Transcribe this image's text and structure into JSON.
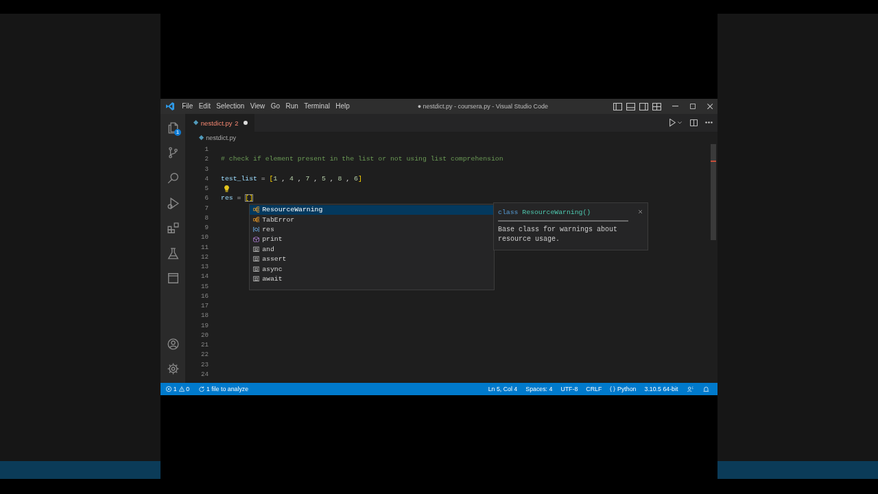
{
  "window": {
    "title": "● nestdict.py - coursera.py - Visual Studio Code"
  },
  "menu": [
    "File",
    "Edit",
    "Selection",
    "View",
    "Go",
    "Run",
    "Terminal",
    "Help"
  ],
  "activity_bar": {
    "top": [
      {
        "kind": "explorer",
        "badge": "1"
      },
      {
        "kind": "source-control"
      },
      {
        "kind": "search"
      },
      {
        "kind": "run-debug"
      },
      {
        "kind": "extensions"
      },
      {
        "kind": "testing"
      },
      {
        "kind": "panel"
      }
    ],
    "bottom": [
      {
        "kind": "account"
      },
      {
        "kind": "settings"
      }
    ]
  },
  "tabs": [
    {
      "label": "nestdict.py",
      "problems": "2",
      "modified": true,
      "selected": true
    }
  ],
  "breadcrumb": [
    "nestdict.py"
  ],
  "editor": {
    "lines": [
      {
        "number": "1",
        "lightbulb": false
      },
      {
        "number": "2",
        "lightbulb": false,
        "tokens": [
          {
            "text": "# check if element present in the list or not using list comprehension",
            "kind": "comment"
          }
        ]
      },
      {
        "number": "3",
        "lightbulb": false
      },
      {
        "number": "4",
        "lightbulb": false,
        "tokens": [
          {
            "text": "test_list",
            "kind": "variable"
          },
          {
            "text": " = ",
            "kind": "plain"
          },
          {
            "text": "[",
            "kind": "bracket"
          },
          {
            "text": "1",
            "kind": "number"
          },
          {
            "text": " , ",
            "kind": "plain"
          },
          {
            "text": "4",
            "kind": "number"
          },
          {
            "text": " , ",
            "kind": "plain"
          },
          {
            "text": "7",
            "kind": "number"
          },
          {
            "text": " , ",
            "kind": "plain"
          },
          {
            "text": "5",
            "kind": "number"
          },
          {
            "text": " , ",
            "kind": "plain"
          },
          {
            "text": "8",
            "kind": "number"
          },
          {
            "text": " , ",
            "kind": "plain"
          },
          {
            "text": "6",
            "kind": "number"
          },
          {
            "text": "]",
            "kind": "bracket"
          }
        ]
      },
      {
        "number": "5",
        "lightbulb": true
      },
      {
        "number": "6",
        "lightbulb": false,
        "tokens": [
          {
            "text": "res",
            "kind": "variable"
          },
          {
            "text": " = ",
            "kind": "plain"
          },
          {
            "text": "[]",
            "kind": "bracket-match"
          }
        ]
      },
      {
        "number": "7",
        "lightbulb": false
      },
      {
        "number": "8",
        "lightbulb": false
      },
      {
        "number": "9",
        "lightbulb": false
      },
      {
        "number": "10",
        "lightbulb": false
      },
      {
        "number": "11",
        "lightbulb": false
      },
      {
        "number": "12",
        "lightbulb": false
      },
      {
        "number": "13",
        "lightbulb": false
      },
      {
        "number": "14",
        "lightbulb": false
      },
      {
        "number": "15",
        "lightbulb": false
      },
      {
        "number": "16",
        "lightbulb": false
      },
      {
        "number": "17",
        "lightbulb": false
      },
      {
        "number": "18",
        "lightbulb": false
      },
      {
        "number": "19",
        "lightbulb": false
      },
      {
        "number": "20",
        "lightbulb": false
      },
      {
        "number": "21",
        "lightbulb": false
      },
      {
        "number": "22",
        "lightbulb": false
      },
      {
        "number": "23",
        "lightbulb": false
      },
      {
        "number": "24",
        "lightbulb": false
      }
    ]
  },
  "suggestions": [
    {
      "label": "ResourceWarning",
      "kind": "class",
      "selected": true
    },
    {
      "label": "TabError",
      "kind": "class",
      "selected": false
    },
    {
      "label": "res",
      "kind": "variable",
      "selected": false
    },
    {
      "label": "print",
      "kind": "function",
      "selected": false
    },
    {
      "label": "and",
      "kind": "keyword",
      "selected": false
    },
    {
      "label": "assert",
      "kind": "keyword",
      "selected": false
    },
    {
      "label": "async",
      "kind": "keyword",
      "selected": false
    },
    {
      "label": "await",
      "kind": "keyword",
      "selected": false
    }
  ],
  "details": {
    "signature": [
      {
        "text": "class",
        "kind": "keyword"
      },
      {
        "text": " ResourceWarning()",
        "kind": "type"
      }
    ],
    "description": "Base class for warnings about resource usage."
  },
  "status_bar": {
    "left": [
      {
        "kind": "problems",
        "errors": "1",
        "warnings": "0"
      },
      {
        "kind": "analysis",
        "text": "1 file to analyze"
      }
    ],
    "right": [
      {
        "kind": "text",
        "text": "Ln 5, Col 4"
      },
      {
        "kind": "text",
        "text": "Spaces: 4"
      },
      {
        "kind": "text",
        "text": "UTF-8"
      },
      {
        "kind": "text",
        "text": "CRLF"
      },
      {
        "kind": "language",
        "text": "Python"
      },
      {
        "kind": "text",
        "text": "3.10.5 64-bit"
      },
      {
        "kind": "feedback"
      },
      {
        "kind": "bell"
      }
    ]
  }
}
